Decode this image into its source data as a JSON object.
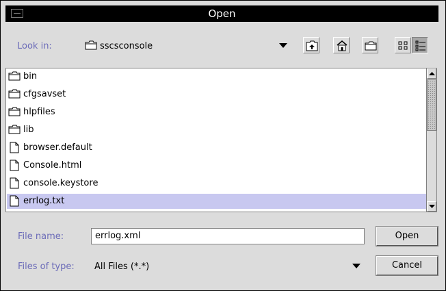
{
  "window": {
    "title": "Open"
  },
  "toolbar": {
    "look_in_label": "Look in:",
    "look_in_value": "sscsconsole",
    "buttons": [
      {
        "name": "up-one-level-icon"
      },
      {
        "name": "home-icon"
      },
      {
        "name": "new-folder-icon"
      },
      {
        "name": "list-view-icon"
      },
      {
        "name": "details-view-icon",
        "selected": true
      }
    ]
  },
  "files": [
    {
      "name": "bin",
      "type": "folder"
    },
    {
      "name": "cfgsavset",
      "type": "folder"
    },
    {
      "name": "hlpfiles",
      "type": "folder"
    },
    {
      "name": "lib",
      "type": "folder"
    },
    {
      "name": "browser.default",
      "type": "file"
    },
    {
      "name": "Console.html",
      "type": "file"
    },
    {
      "name": "console.keystore",
      "type": "file"
    },
    {
      "name": "errlog.txt",
      "type": "file",
      "selected": true
    }
  ],
  "form": {
    "file_name_label": "File name:",
    "file_name_value": "errlog.xml",
    "files_of_type_label": "Files of type:",
    "files_of_type_value": "All Files (*.*)",
    "open_label": "Open",
    "cancel_label": "Cancel"
  },
  "colors": {
    "selection": "#c8c8f0",
    "label": "#6b6bb8",
    "titlebar": "#000000"
  }
}
